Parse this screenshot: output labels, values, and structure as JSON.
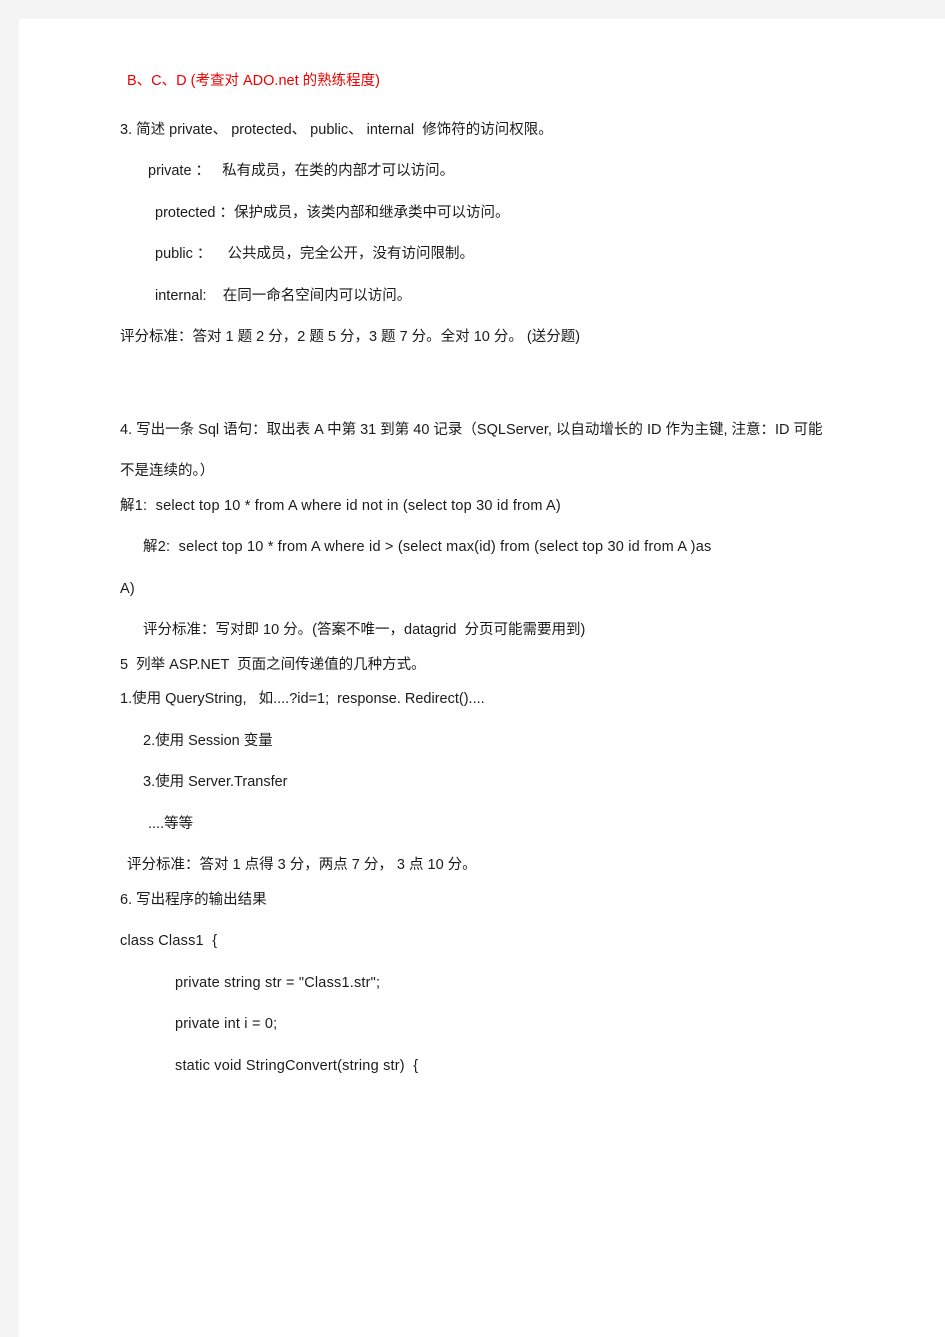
{
  "document": {
    "page_background": "#ffffff",
    "frame_background": "#f4f4f4",
    "accent_red": "#ee0000",
    "body_color": "#1b1b1b"
  },
  "content": {
    "answer_bcd": "B、C、D (考查对 ADO.net 的熟练程度)",
    "q3": {
      "heading": "3. 简述 private、 protected、 public、 internal  修饰符的访问权限。",
      "items": [
        "private ：   私有成员，在类的内部才可以访问。",
        "protected ：保护成员，该类内部和继承类中可以访问。",
        "public ：    公共成员，完全公开，没有访问限制。",
        "internal:    在同一命名空间内可以访问。"
      ],
      "scoring": "评分标准：答对 1 题 2 分，2 题 5 分，3 题 7 分。全对 10 分。 (送分题)"
    },
    "q4": {
      "heading_line1": "4. 写出一条 Sql 语句：取出表 A 中第 31 到第 40 记录（SQLServer, 以自动增长的 ID 作为主键, 注意：ID 可能",
      "heading_line2": "不是连续的。）",
      "solution1": "解1:  select top 10 * from A where id not in (select top 30 id from A)",
      "solution2_line1": "解2:  select top 10 * from A where id > (select max(id) from (select top 30 id from A )as",
      "solution2_line2": "A)",
      "scoring": "评分标准：写对即 10 分。(答案不唯一，datagrid  分页可能需要用到)"
    },
    "q5": {
      "heading": "5  列举 ASP.NET  页面之间传递值的几种方式。",
      "items": [
        "1.使用 QueryString,   如....?id=1;  response. Redirect()....",
        "2.使用 Session 变量",
        "3.使用 Server.Transfer",
        "....等等"
      ],
      "scoring": "评分标准：答对 1 点得 3 分，两点 7 分， 3 点 10 分。"
    },
    "q6": {
      "heading": "6. 写出程序的输出结果",
      "code": [
        "class Class1  {",
        "private string str = \"Class1.str\";",
        "private int i = 0;",
        "static void StringConvert(string str)  {"
      ]
    }
  }
}
